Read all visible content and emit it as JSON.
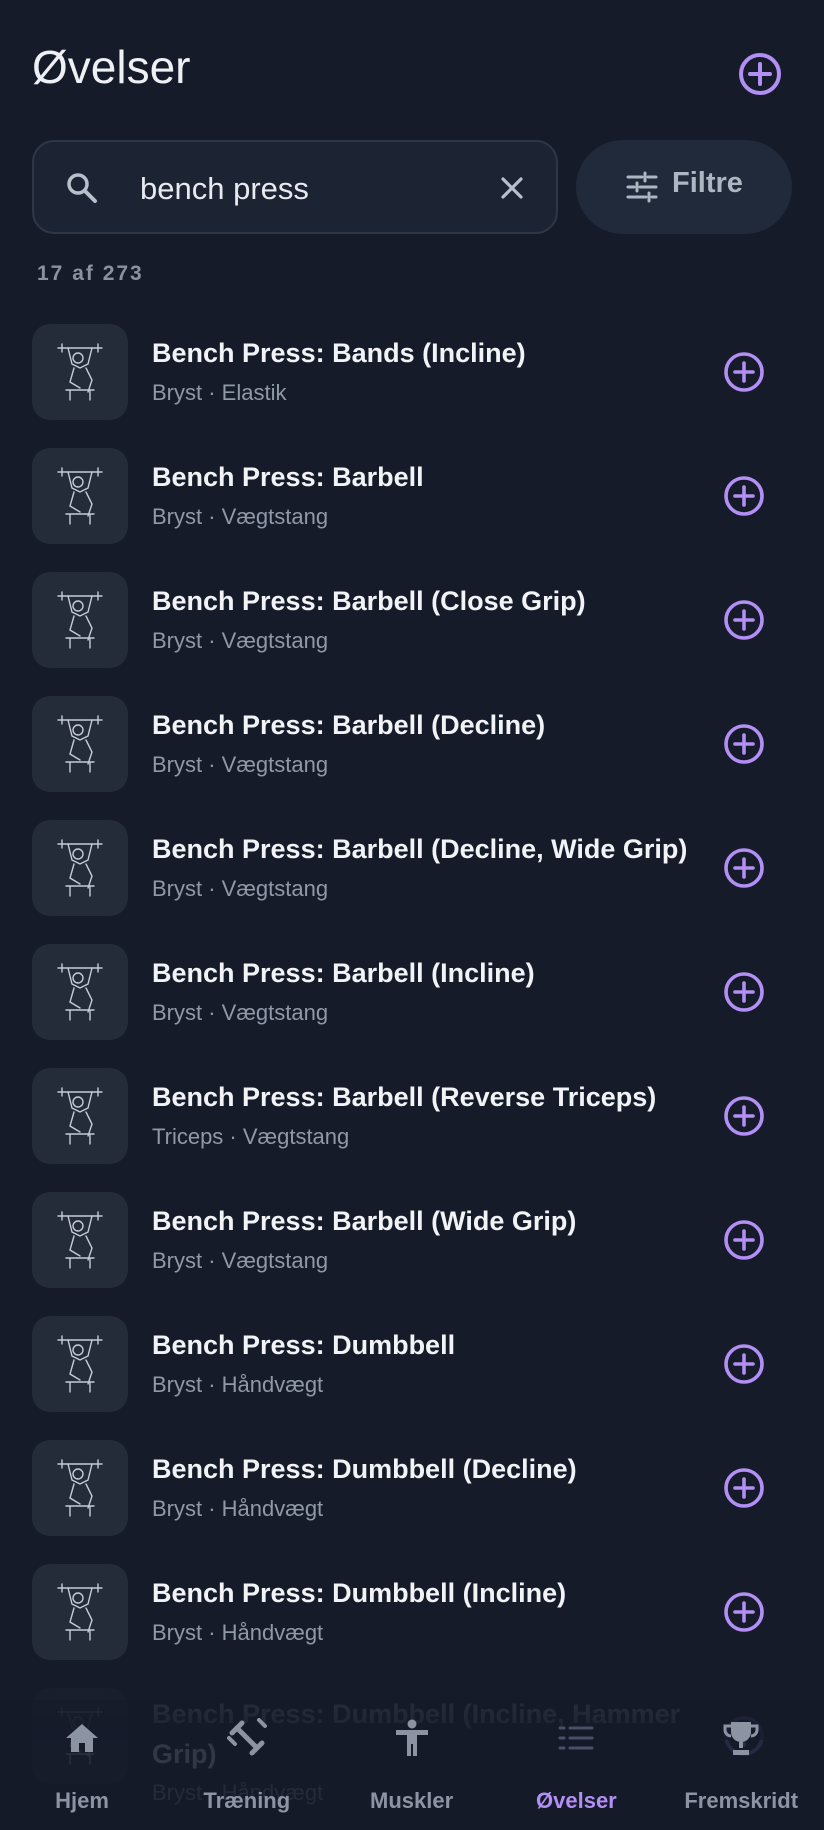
{
  "header": {
    "title": "Øvelser"
  },
  "search": {
    "value": "bench press",
    "placeholder": ""
  },
  "filter": {
    "label": "Filtre"
  },
  "results": {
    "count_text": "17 af 273"
  },
  "exercises": [
    {
      "name": "Bench Press: Bands (Incline)",
      "sub": "Bryst · Elastik"
    },
    {
      "name": "Bench Press: Barbell",
      "sub": "Bryst · Vægtstang"
    },
    {
      "name": "Bench Press: Barbell (Close Grip)",
      "sub": "Bryst · Vægtstang"
    },
    {
      "name": "Bench Press: Barbell (Decline)",
      "sub": "Bryst · Vægtstang"
    },
    {
      "name": "Bench Press: Barbell (Decline, Wide Grip)",
      "sub": "Bryst · Vægtstang"
    },
    {
      "name": "Bench Press: Barbell (Incline)",
      "sub": "Bryst · Vægtstang"
    },
    {
      "name": "Bench Press: Barbell (Reverse Triceps)",
      "sub": "Triceps · Vægtstang"
    },
    {
      "name": "Bench Press: Barbell (Wide Grip)",
      "sub": "Bryst · Vægtstang"
    },
    {
      "name": "Bench Press: Dumbbell",
      "sub": "Bryst · Håndvægt"
    },
    {
      "name": "Bench Press: Dumbbell (Decline)",
      "sub": "Bryst · Håndvægt"
    },
    {
      "name": "Bench Press: Dumbbell (Incline)",
      "sub": "Bryst · Håndvægt"
    },
    {
      "name": "Bench Press: Dumbbell (Incline, Hammer Grip)",
      "sub": "Bryst · Håndvægt"
    }
  ],
  "nav": {
    "items": [
      {
        "label": "Hjem",
        "icon": "home-icon"
      },
      {
        "label": "Træning",
        "icon": "dumbbell-icon"
      },
      {
        "label": "Muskler",
        "icon": "body-icon"
      },
      {
        "label": "Øvelser",
        "icon": "list-icon"
      },
      {
        "label": "Fremskridt",
        "icon": "trophy-icon"
      }
    ],
    "active": "Øvelser"
  },
  "colors": {
    "accent": "#b28ef5",
    "background": "#151b29",
    "surface": "#1c2434"
  }
}
